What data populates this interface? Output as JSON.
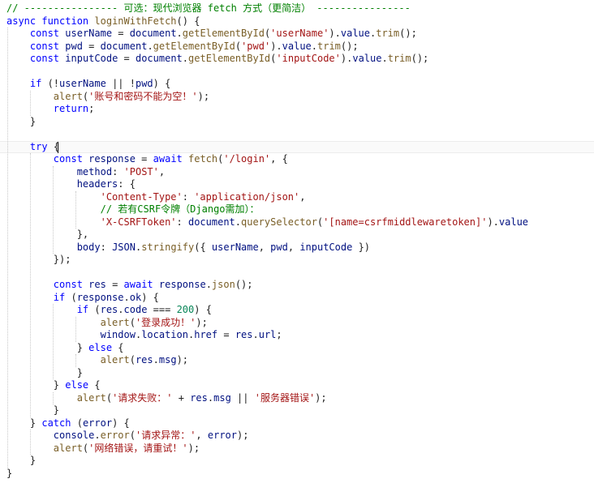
{
  "editor": {
    "lines": [
      {
        "indent": 0,
        "tokens": [
          {
            "t": "cmt",
            "v": "// ---------------- 可选：现代浏览器 fetch 方式（更简洁） ----------------"
          }
        ]
      },
      {
        "indent": 0,
        "tokens": [
          {
            "t": "kw",
            "v": "async"
          },
          {
            "t": "",
            "v": " "
          },
          {
            "t": "kw",
            "v": "function"
          },
          {
            "t": "",
            "v": " "
          },
          {
            "t": "fn",
            "v": "loginWithFetch"
          },
          {
            "t": "",
            "v": "() {"
          }
        ]
      },
      {
        "indent": 1,
        "tokens": [
          {
            "t": "kw",
            "v": "const"
          },
          {
            "t": "",
            "v": " "
          },
          {
            "t": "var",
            "v": "userName"
          },
          {
            "t": "",
            "v": " = "
          },
          {
            "t": "var",
            "v": "document"
          },
          {
            "t": "",
            "v": "."
          },
          {
            "t": "fn",
            "v": "getElementById"
          },
          {
            "t": "",
            "v": "("
          },
          {
            "t": "str",
            "v": "'userName'"
          },
          {
            "t": "",
            "v": ")."
          },
          {
            "t": "var",
            "v": "value"
          },
          {
            "t": "",
            "v": "."
          },
          {
            "t": "fn",
            "v": "trim"
          },
          {
            "t": "",
            "v": "();"
          }
        ]
      },
      {
        "indent": 1,
        "tokens": [
          {
            "t": "kw",
            "v": "const"
          },
          {
            "t": "",
            "v": " "
          },
          {
            "t": "var",
            "v": "pwd"
          },
          {
            "t": "",
            "v": " = "
          },
          {
            "t": "var",
            "v": "document"
          },
          {
            "t": "",
            "v": "."
          },
          {
            "t": "fn",
            "v": "getElementById"
          },
          {
            "t": "",
            "v": "("
          },
          {
            "t": "str",
            "v": "'pwd'"
          },
          {
            "t": "",
            "v": ")."
          },
          {
            "t": "var",
            "v": "value"
          },
          {
            "t": "",
            "v": "."
          },
          {
            "t": "fn",
            "v": "trim"
          },
          {
            "t": "",
            "v": "();"
          }
        ]
      },
      {
        "indent": 1,
        "tokens": [
          {
            "t": "kw",
            "v": "const"
          },
          {
            "t": "",
            "v": " "
          },
          {
            "t": "var",
            "v": "inputCode"
          },
          {
            "t": "",
            "v": " = "
          },
          {
            "t": "var",
            "v": "document"
          },
          {
            "t": "",
            "v": "."
          },
          {
            "t": "fn",
            "v": "getElementById"
          },
          {
            "t": "",
            "v": "("
          },
          {
            "t": "str",
            "v": "'inputCode'"
          },
          {
            "t": "",
            "v": ")."
          },
          {
            "t": "var",
            "v": "value"
          },
          {
            "t": "",
            "v": "."
          },
          {
            "t": "fn",
            "v": "trim"
          },
          {
            "t": "",
            "v": "();"
          }
        ]
      },
      {
        "indent": 0,
        "tokens": []
      },
      {
        "indent": 1,
        "tokens": [
          {
            "t": "kw",
            "v": "if"
          },
          {
            "t": "",
            "v": " (!"
          },
          {
            "t": "var",
            "v": "userName"
          },
          {
            "t": "",
            "v": " || !"
          },
          {
            "t": "var",
            "v": "pwd"
          },
          {
            "t": "",
            "v": ") {"
          }
        ]
      },
      {
        "indent": 2,
        "tokens": [
          {
            "t": "fn",
            "v": "alert"
          },
          {
            "t": "",
            "v": "("
          },
          {
            "t": "str",
            "v": "'账号和密码不能为空！'"
          },
          {
            "t": "",
            "v": ");"
          }
        ]
      },
      {
        "indent": 2,
        "tokens": [
          {
            "t": "kw",
            "v": "return"
          },
          {
            "t": "",
            "v": ";"
          }
        ]
      },
      {
        "indent": 1,
        "tokens": [
          {
            "t": "",
            "v": "}"
          }
        ]
      },
      {
        "indent": 0,
        "tokens": []
      },
      {
        "indent": 1,
        "tokens": [
          {
            "t": "kw",
            "v": "try"
          },
          {
            "t": "",
            "v": " {"
          }
        ]
      },
      {
        "indent": 2,
        "tokens": [
          {
            "t": "kw",
            "v": "const"
          },
          {
            "t": "",
            "v": " "
          },
          {
            "t": "var",
            "v": "response"
          },
          {
            "t": "",
            "v": " = "
          },
          {
            "t": "kw",
            "v": "await"
          },
          {
            "t": "",
            "v": " "
          },
          {
            "t": "fn",
            "v": "fetch"
          },
          {
            "t": "",
            "v": "("
          },
          {
            "t": "str",
            "v": "'/login'"
          },
          {
            "t": "",
            "v": ", {"
          }
        ]
      },
      {
        "indent": 3,
        "tokens": [
          {
            "t": "var",
            "v": "method"
          },
          {
            "t": "",
            "v": ": "
          },
          {
            "t": "str",
            "v": "'POST'"
          },
          {
            "t": "",
            "v": ","
          }
        ]
      },
      {
        "indent": 3,
        "tokens": [
          {
            "t": "var",
            "v": "headers"
          },
          {
            "t": "",
            "v": ": {"
          }
        ]
      },
      {
        "indent": 4,
        "tokens": [
          {
            "t": "str",
            "v": "'Content-Type'"
          },
          {
            "t": "",
            "v": ": "
          },
          {
            "t": "str",
            "v": "'application/json'"
          },
          {
            "t": "",
            "v": ","
          }
        ]
      },
      {
        "indent": 4,
        "tokens": [
          {
            "t": "cmt",
            "v": "// 若有CSRF令牌（Django需加）："
          }
        ]
      },
      {
        "indent": 4,
        "tokens": [
          {
            "t": "str",
            "v": "'X-CSRFToken'"
          },
          {
            "t": "",
            "v": ": "
          },
          {
            "t": "var",
            "v": "document"
          },
          {
            "t": "",
            "v": "."
          },
          {
            "t": "fn",
            "v": "querySelector"
          },
          {
            "t": "",
            "v": "("
          },
          {
            "t": "str",
            "v": "'[name=csrfmiddlewaretoken]'"
          },
          {
            "t": "",
            "v": ")."
          },
          {
            "t": "var",
            "v": "value"
          }
        ]
      },
      {
        "indent": 3,
        "tokens": [
          {
            "t": "",
            "v": "},"
          }
        ]
      },
      {
        "indent": 3,
        "tokens": [
          {
            "t": "var",
            "v": "body"
          },
          {
            "t": "",
            "v": ": "
          },
          {
            "t": "var",
            "v": "JSON"
          },
          {
            "t": "",
            "v": "."
          },
          {
            "t": "fn",
            "v": "stringify"
          },
          {
            "t": "",
            "v": "({ "
          },
          {
            "t": "var",
            "v": "userName"
          },
          {
            "t": "",
            "v": ", "
          },
          {
            "t": "var",
            "v": "pwd"
          },
          {
            "t": "",
            "v": ", "
          },
          {
            "t": "var",
            "v": "inputCode"
          },
          {
            "t": "",
            "v": " })"
          }
        ]
      },
      {
        "indent": 2,
        "tokens": [
          {
            "t": "",
            "v": "});"
          }
        ]
      },
      {
        "indent": 0,
        "tokens": []
      },
      {
        "indent": 2,
        "tokens": [
          {
            "t": "kw",
            "v": "const"
          },
          {
            "t": "",
            "v": " "
          },
          {
            "t": "var",
            "v": "res"
          },
          {
            "t": "",
            "v": " = "
          },
          {
            "t": "kw",
            "v": "await"
          },
          {
            "t": "",
            "v": " "
          },
          {
            "t": "var",
            "v": "response"
          },
          {
            "t": "",
            "v": "."
          },
          {
            "t": "fn",
            "v": "json"
          },
          {
            "t": "",
            "v": "();"
          }
        ]
      },
      {
        "indent": 2,
        "tokens": [
          {
            "t": "kw",
            "v": "if"
          },
          {
            "t": "",
            "v": " ("
          },
          {
            "t": "var",
            "v": "response"
          },
          {
            "t": "",
            "v": "."
          },
          {
            "t": "var",
            "v": "ok"
          },
          {
            "t": "",
            "v": ") {"
          }
        ]
      },
      {
        "indent": 3,
        "tokens": [
          {
            "t": "kw",
            "v": "if"
          },
          {
            "t": "",
            "v": " ("
          },
          {
            "t": "var",
            "v": "res"
          },
          {
            "t": "",
            "v": "."
          },
          {
            "t": "var",
            "v": "code"
          },
          {
            "t": "",
            "v": " === "
          },
          {
            "t": "num",
            "v": "200"
          },
          {
            "t": "",
            "v": ") {"
          }
        ]
      },
      {
        "indent": 4,
        "tokens": [
          {
            "t": "fn",
            "v": "alert"
          },
          {
            "t": "",
            "v": "("
          },
          {
            "t": "str",
            "v": "'登录成功！'"
          },
          {
            "t": "",
            "v": ");"
          }
        ]
      },
      {
        "indent": 4,
        "tokens": [
          {
            "t": "var",
            "v": "window"
          },
          {
            "t": "",
            "v": "."
          },
          {
            "t": "var",
            "v": "location"
          },
          {
            "t": "",
            "v": "."
          },
          {
            "t": "var",
            "v": "href"
          },
          {
            "t": "",
            "v": " = "
          },
          {
            "t": "var",
            "v": "res"
          },
          {
            "t": "",
            "v": "."
          },
          {
            "t": "var",
            "v": "url"
          },
          {
            "t": "",
            "v": ";"
          }
        ]
      },
      {
        "indent": 3,
        "tokens": [
          {
            "t": "",
            "v": "} "
          },
          {
            "t": "kw",
            "v": "else"
          },
          {
            "t": "",
            "v": " {"
          }
        ]
      },
      {
        "indent": 4,
        "tokens": [
          {
            "t": "fn",
            "v": "alert"
          },
          {
            "t": "",
            "v": "("
          },
          {
            "t": "var",
            "v": "res"
          },
          {
            "t": "",
            "v": "."
          },
          {
            "t": "var",
            "v": "msg"
          },
          {
            "t": "",
            "v": ");"
          }
        ]
      },
      {
        "indent": 3,
        "tokens": [
          {
            "t": "",
            "v": "}"
          }
        ]
      },
      {
        "indent": 2,
        "tokens": [
          {
            "t": "",
            "v": "} "
          },
          {
            "t": "kw",
            "v": "else"
          },
          {
            "t": "",
            "v": " {"
          }
        ]
      },
      {
        "indent": 3,
        "tokens": [
          {
            "t": "fn",
            "v": "alert"
          },
          {
            "t": "",
            "v": "("
          },
          {
            "t": "str",
            "v": "'请求失败：'"
          },
          {
            "t": "",
            "v": " + "
          },
          {
            "t": "var",
            "v": "res"
          },
          {
            "t": "",
            "v": "."
          },
          {
            "t": "var",
            "v": "msg"
          },
          {
            "t": "",
            "v": " || "
          },
          {
            "t": "str",
            "v": "'服务器错误'"
          },
          {
            "t": "",
            "v": ");"
          }
        ]
      },
      {
        "indent": 2,
        "tokens": [
          {
            "t": "",
            "v": "}"
          }
        ]
      },
      {
        "indent": 1,
        "tokens": [
          {
            "t": "",
            "v": "} "
          },
          {
            "t": "kw",
            "v": "catch"
          },
          {
            "t": "",
            "v": " ("
          },
          {
            "t": "var",
            "v": "error"
          },
          {
            "t": "",
            "v": ") {"
          }
        ]
      },
      {
        "indent": 2,
        "tokens": [
          {
            "t": "var",
            "v": "console"
          },
          {
            "t": "",
            "v": "."
          },
          {
            "t": "fn",
            "v": "error"
          },
          {
            "t": "",
            "v": "("
          },
          {
            "t": "str",
            "v": "'请求异常：'"
          },
          {
            "t": "",
            "v": ", "
          },
          {
            "t": "var",
            "v": "error"
          },
          {
            "t": "",
            "v": ");"
          }
        ]
      },
      {
        "indent": 2,
        "tokens": [
          {
            "t": "fn",
            "v": "alert"
          },
          {
            "t": "",
            "v": "("
          },
          {
            "t": "str",
            "v": "'网络错误，请重试！'"
          },
          {
            "t": "",
            "v": ");"
          }
        ]
      },
      {
        "indent": 1,
        "tokens": [
          {
            "t": "",
            "v": "}"
          }
        ]
      },
      {
        "indent": 0,
        "tokens": [
          {
            "t": "",
            "v": "}"
          }
        ]
      }
    ],
    "colors": {
      "keyword": "#0000ff",
      "function": "#795e26",
      "string": "#a31515",
      "variable": "#001080",
      "number": "#098658",
      "comment": "#008000"
    }
  }
}
